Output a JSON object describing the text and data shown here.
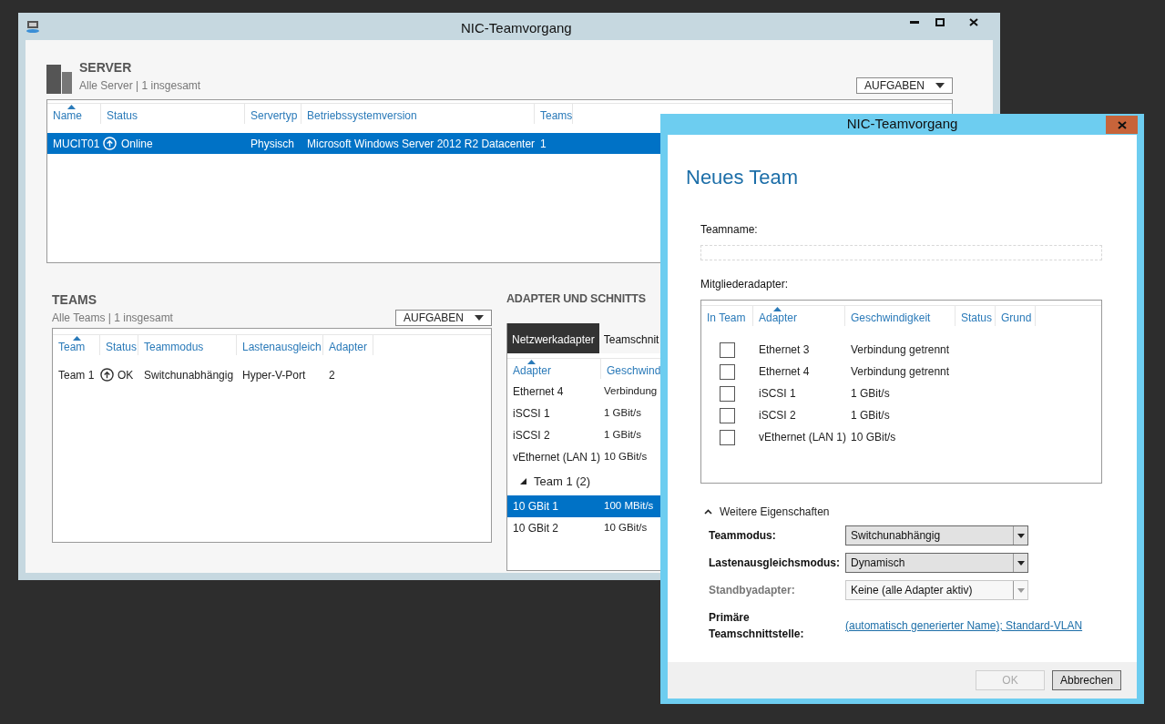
{
  "main_window": {
    "title": "NIC-Teamvorgang"
  },
  "server": {
    "title": "SERVER",
    "subtitle": "Alle Server | 1 insgesamt",
    "tasks_button": "AUFGABEN",
    "columns": [
      {
        "label": "Name",
        "sorted": true
      },
      {
        "label": "Status",
        "sorted": false
      },
      {
        "label": "Servertyp",
        "sorted": false
      },
      {
        "label": "Betriebssystemversion",
        "sorted": false
      },
      {
        "label": "Teams",
        "sorted": false
      }
    ],
    "rows": [
      {
        "name": "MUCIT01",
        "status": "Online",
        "type": "Physisch",
        "os": "Microsoft Windows Server 2012 R2 Datacenter",
        "teams": "1",
        "selected": true
      }
    ]
  },
  "teams": {
    "title": "TEAMS",
    "subtitle": "Alle Teams | 1 insgesamt",
    "tasks_button": "AUFGABEN",
    "columns": [
      {
        "label": "Team",
        "sorted": true
      },
      {
        "label": "Status",
        "sorted": false
      },
      {
        "label": "Teammodus",
        "sorted": false
      },
      {
        "label": "Lastenausgleich",
        "sorted": false
      },
      {
        "label": "Adapter",
        "sorted": false
      }
    ],
    "rows": [
      {
        "team": "Team 1",
        "status": "OK",
        "mode": "Switchunabhängig",
        "balancing": "Hyper-V-Port",
        "adapters": "2",
        "selected": false
      }
    ]
  },
  "adapters": {
    "title": "ADAPTER UND SCHNITTS",
    "tabs": [
      {
        "label": "Netzwerkadapter",
        "selected": true
      },
      {
        "label": "Teamschnit",
        "selected": false
      }
    ],
    "columns": [
      {
        "label": "Adapter",
        "sorted": true
      },
      {
        "label": "Geschwind",
        "sorted": false
      }
    ],
    "rows": [
      {
        "kind": "item",
        "adapter": "Ethernet 4",
        "speed": "Verbindung",
        "selected": false
      },
      {
        "kind": "item",
        "adapter": "iSCSI 1",
        "speed": "1 GBit/s",
        "selected": false
      },
      {
        "kind": "item",
        "adapter": "iSCSI 2",
        "speed": "1 GBit/s",
        "selected": false
      },
      {
        "kind": "item",
        "adapter": "vEthernet (LAN 1)",
        "speed": "10 GBit/s",
        "selected": false
      },
      {
        "kind": "group",
        "label": "Team 1 (2)",
        "expanded": true
      },
      {
        "kind": "item",
        "adapter": "10 GBit 1",
        "speed": "100 MBit/s",
        "selected": true
      },
      {
        "kind": "item",
        "adapter": "10 GBit 2",
        "speed": "10 GBit/s",
        "selected": false
      }
    ]
  },
  "dialog": {
    "title": "NIC-Teamvorgang",
    "heading": "Neues Team",
    "teamname_label": "Teamname:",
    "members_label": "Mitgliederadapter:",
    "member_columns": [
      {
        "label": "In Team",
        "sorted": false
      },
      {
        "label": "Adapter",
        "sorted": true
      },
      {
        "label": "Geschwindigkeit",
        "sorted": false
      },
      {
        "label": "Status",
        "sorted": false
      },
      {
        "label": "Grund",
        "sorted": false
      }
    ],
    "members": [
      {
        "adapter": "Ethernet 3",
        "speed": "Verbindung getrennt",
        "checked": false
      },
      {
        "adapter": "Ethernet 4",
        "speed": "Verbindung getrennt",
        "checked": false
      },
      {
        "adapter": "iSCSI 1",
        "speed": "1 GBit/s",
        "checked": false
      },
      {
        "adapter": "iSCSI 2",
        "speed": "1 GBit/s",
        "checked": false
      },
      {
        "adapter": "vEthernet (LAN 1)",
        "speed": "10 GBit/s",
        "checked": false
      }
    ],
    "more": {
      "label": "Weitere Eigenschaften",
      "expanded": true
    },
    "properties": [
      {
        "label": "Teammodus:",
        "value": "Switchunabhängig",
        "disabled": false
      },
      {
        "label": "Lastenausgleichsmodus:",
        "value": "Dynamisch",
        "disabled": false
      },
      {
        "label": "Standbyadapter:",
        "value": "Keine (alle Adapter aktiv)",
        "disabled": true
      }
    ],
    "primary": {
      "label": "Primäre Teamschnittstelle:",
      "link": "(automatisch generierter Name); Standard-VLAN"
    },
    "buttons": [
      {
        "label": "OK",
        "disabled": true
      },
      {
        "label": "Abbrechen",
        "disabled": false
      }
    ]
  }
}
